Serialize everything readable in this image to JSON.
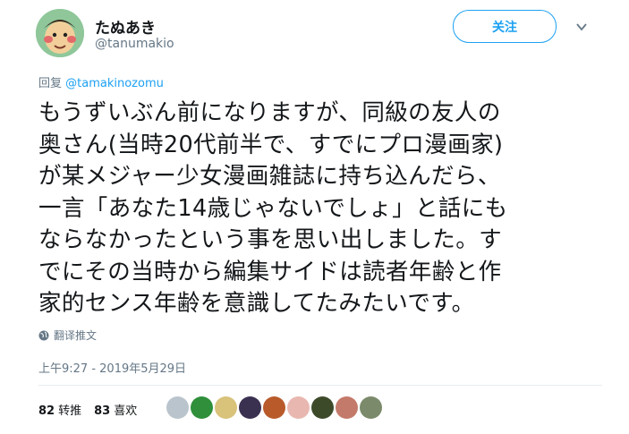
{
  "user": {
    "display_name": "たぬあき",
    "handle": "@tanumakio"
  },
  "follow_button": {
    "label": "关注"
  },
  "reply_context": {
    "prefix": "回复",
    "mention": "@tamakinozomu"
  },
  "tweet": {
    "lines": [
      "もうずいぶん前になりますが、同級の友人の",
      "奥さん(当時20代前半で、すでにプロ漫画家)",
      "が某メジャー少女漫画雑誌に持ち込んだら、",
      "一言「あなた14歳じゃないでしょ」と話にも",
      "ならなかったという事を思い出しました。す",
      "でにその当時から編集サイドは読者年齢と作",
      "家的センス年齢を意識してたみたいです。"
    ]
  },
  "translate_label": "翻译推文",
  "timestamp": "上午9:27 - 2019年5月29日",
  "stats": {
    "retweets_count": "82",
    "retweets_label": "转推",
    "likes_count": "83",
    "likes_label": "喜欢"
  },
  "likers_colors": [
    "#b9c4cc",
    "#2f8f3a",
    "#d9c27a",
    "#3a3050",
    "#b85a2a",
    "#e8b8b0",
    "#3d4a2a",
    "#c47a6a",
    "#7a8a6a"
  ]
}
